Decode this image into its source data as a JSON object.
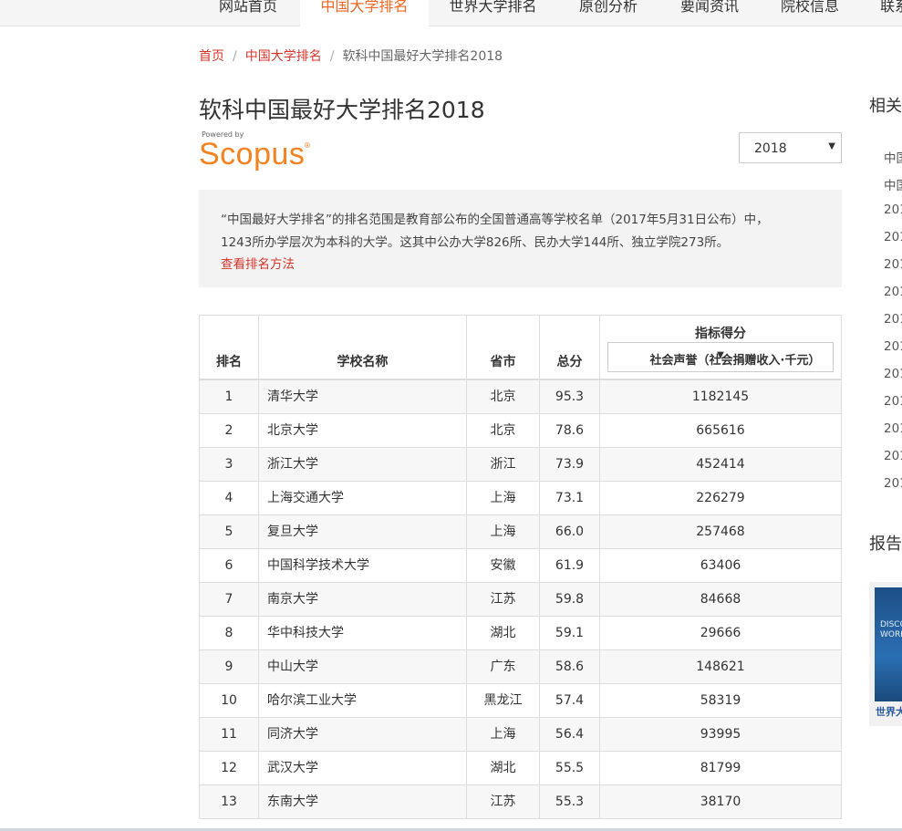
{
  "nav": {
    "items": [
      {
        "label": "网站首页"
      },
      {
        "label": "中国大学排名"
      },
      {
        "label": "世界大学排名"
      },
      {
        "label": "原创分析"
      },
      {
        "label": "要闻资讯"
      },
      {
        "label": "院校信息"
      },
      {
        "label": "联系"
      }
    ],
    "active_color": "#f26522"
  },
  "breadcrumb": {
    "home": "首页",
    "section": "中国大学排名",
    "current": "软科中国最好大学排名2018"
  },
  "page_title": "软科中国最好大学排名2018",
  "logo": {
    "powered_by": "Powered by",
    "brand": "Scopus",
    "reg": "®"
  },
  "year_select": {
    "value": "2018"
  },
  "info": {
    "line1": "“中国最好大学排名”的排名范围是教育部公布的全国普通高等学校名单（2017年5月31日公布）中，",
    "line2": "1243所办学层次为本科的大学。这其中公办大学826所、民办大学144所、独立学院273所。",
    "link": "查看排名方法"
  },
  "table": {
    "headers": {
      "rank": "排名",
      "name": "学校名称",
      "province": "省市",
      "score": "总分",
      "indicator_group": "指标得分",
      "indicator_select": "社会声誉（社会捐赠收入·千元）"
    },
    "rows": [
      {
        "rank": "1",
        "name": "清华大学",
        "province": "北京",
        "score": "95.3",
        "indicator": "1182145"
      },
      {
        "rank": "2",
        "name": "北京大学",
        "province": "北京",
        "score": "78.6",
        "indicator": "665616"
      },
      {
        "rank": "3",
        "name": "浙江大学",
        "province": "浙江",
        "score": "73.9",
        "indicator": "452414"
      },
      {
        "rank": "4",
        "name": "上海交通大学",
        "province": "上海",
        "score": "73.1",
        "indicator": "226279"
      },
      {
        "rank": "5",
        "name": "复旦大学",
        "province": "上海",
        "score": "66.0",
        "indicator": "257468"
      },
      {
        "rank": "6",
        "name": "中国科学技术大学",
        "province": "安徽",
        "score": "61.9",
        "indicator": "63406"
      },
      {
        "rank": "7",
        "name": "南京大学",
        "province": "江苏",
        "score": "59.8",
        "indicator": "84668"
      },
      {
        "rank": "8",
        "name": "华中科技大学",
        "province": "湖北",
        "score": "59.1",
        "indicator": "29666"
      },
      {
        "rank": "9",
        "name": "中山大学",
        "province": "广东",
        "score": "58.6",
        "indicator": "148621"
      },
      {
        "rank": "10",
        "name": "哈尔滨工业大学",
        "province": "黑龙江",
        "score": "57.4",
        "indicator": "58319"
      },
      {
        "rank": "11",
        "name": "同济大学",
        "province": "上海",
        "score": "56.4",
        "indicator": "93995"
      },
      {
        "rank": "12",
        "name": "武汉大学",
        "province": "湖北",
        "score": "55.5",
        "indicator": "81799"
      },
      {
        "rank": "13",
        "name": "东南大学",
        "province": "江苏",
        "score": "55.3",
        "indicator": "38170"
      }
    ]
  },
  "sidebar": {
    "heading1": "相关",
    "items": [
      "中国",
      "中国",
      "201",
      "201",
      "201",
      "201",
      "201",
      "201",
      "201",
      "201",
      "201",
      "201",
      "201"
    ],
    "heading2": "报告",
    "book": {
      "cover_line1": "DISCO",
      "cover_line2": "WORLD",
      "caption": "世界大"
    }
  }
}
